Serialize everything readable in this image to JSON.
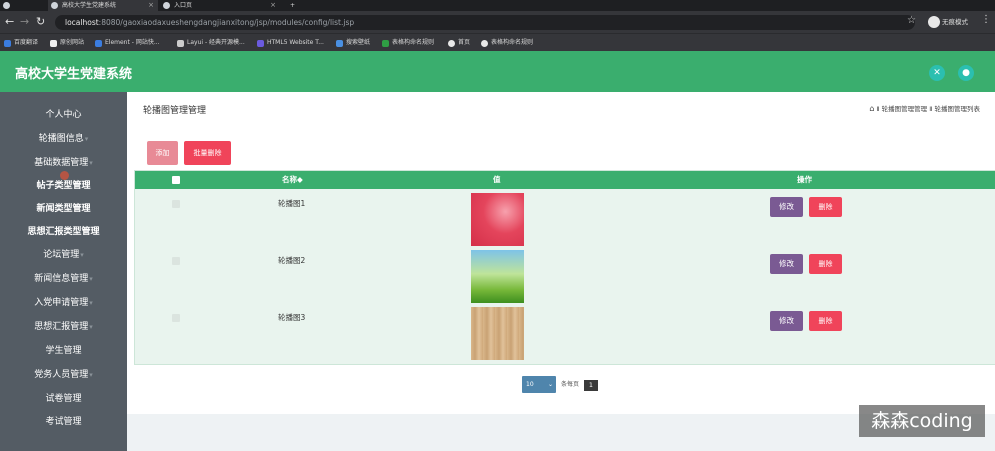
{
  "browser": {
    "tabs": [
      {
        "title": "",
        "active": false
      },
      {
        "title": "高校大学生党建系统",
        "active": true
      },
      {
        "title": "入口页",
        "active": false
      }
    ],
    "new_tab": "+",
    "url_host": "localhost",
    "url_path": ":8080/gaoxiaodaxueshengdangjianxitong/jsp/modules/config/list.jsp",
    "profile": "无痕模式",
    "bookmarks": [
      {
        "label": "百度翻译",
        "color": "#3b7de0"
      },
      {
        "label": "原创网站",
        "color": "#eeeeee"
      },
      {
        "label": "Element - 网站快...",
        "color": "#3b7de0"
      },
      {
        "label": "Layui - 经典开源模...",
        "color": "#cccccc"
      },
      {
        "label": "HTML5 Website T...",
        "color": "#6b5be0"
      },
      {
        "label": "搜索壁纸",
        "color": "#4a90e2"
      },
      {
        "label": "表格构命名规则",
        "color": "#2f9e44"
      },
      {
        "label": "首页",
        "color": "#e8e8e8"
      },
      {
        "label": "表格构命名规则",
        "color": "#e8e8e8"
      }
    ]
  },
  "header": {
    "title": "高校大学生党建系统",
    "brand_color": "#3aae6e"
  },
  "sidebar": {
    "items": [
      {
        "label": "个人中心",
        "bold": false
      },
      {
        "label": "轮播图信息",
        "bold": false
      },
      {
        "label": "基础数据管理",
        "bold": false
      },
      {
        "label": "帖子类型管理",
        "bold": true
      },
      {
        "label": "新闻类型管理",
        "bold": true
      },
      {
        "label": "思想汇报类型管理",
        "bold": true
      },
      {
        "label": "论坛管理",
        "bold": false
      },
      {
        "label": "新闻信息管理",
        "bold": false
      },
      {
        "label": "入党申请管理",
        "bold": false
      },
      {
        "label": "思想汇报管理",
        "bold": false
      },
      {
        "label": "学生管理",
        "bold": false
      },
      {
        "label": "党务人员管理",
        "bold": false
      },
      {
        "label": "试卷管理",
        "bold": false
      },
      {
        "label": "考试管理",
        "bold": false
      }
    ]
  },
  "page": {
    "title": "轮播图管理管理",
    "breadcrumb": "Ⅱ 轮播图管理管理 Ⅱ 轮播图管理列表"
  },
  "toolbar": {
    "add_label": "添加",
    "bulk_delete_label": "批量删除"
  },
  "table": {
    "headers": {
      "name": "名称◆",
      "value": "值",
      "actions": "操作"
    },
    "rows": [
      {
        "name": "轮播图1",
        "edit": "修改",
        "delete": "删除"
      },
      {
        "name": "轮播图2",
        "edit": "修改",
        "delete": "删除"
      },
      {
        "name": "轮播图3",
        "edit": "修改",
        "delete": "删除"
      }
    ]
  },
  "pagination": {
    "page_size": "10",
    "total_label": "条每页",
    "current_page": "1"
  },
  "watermark": "森森coding"
}
